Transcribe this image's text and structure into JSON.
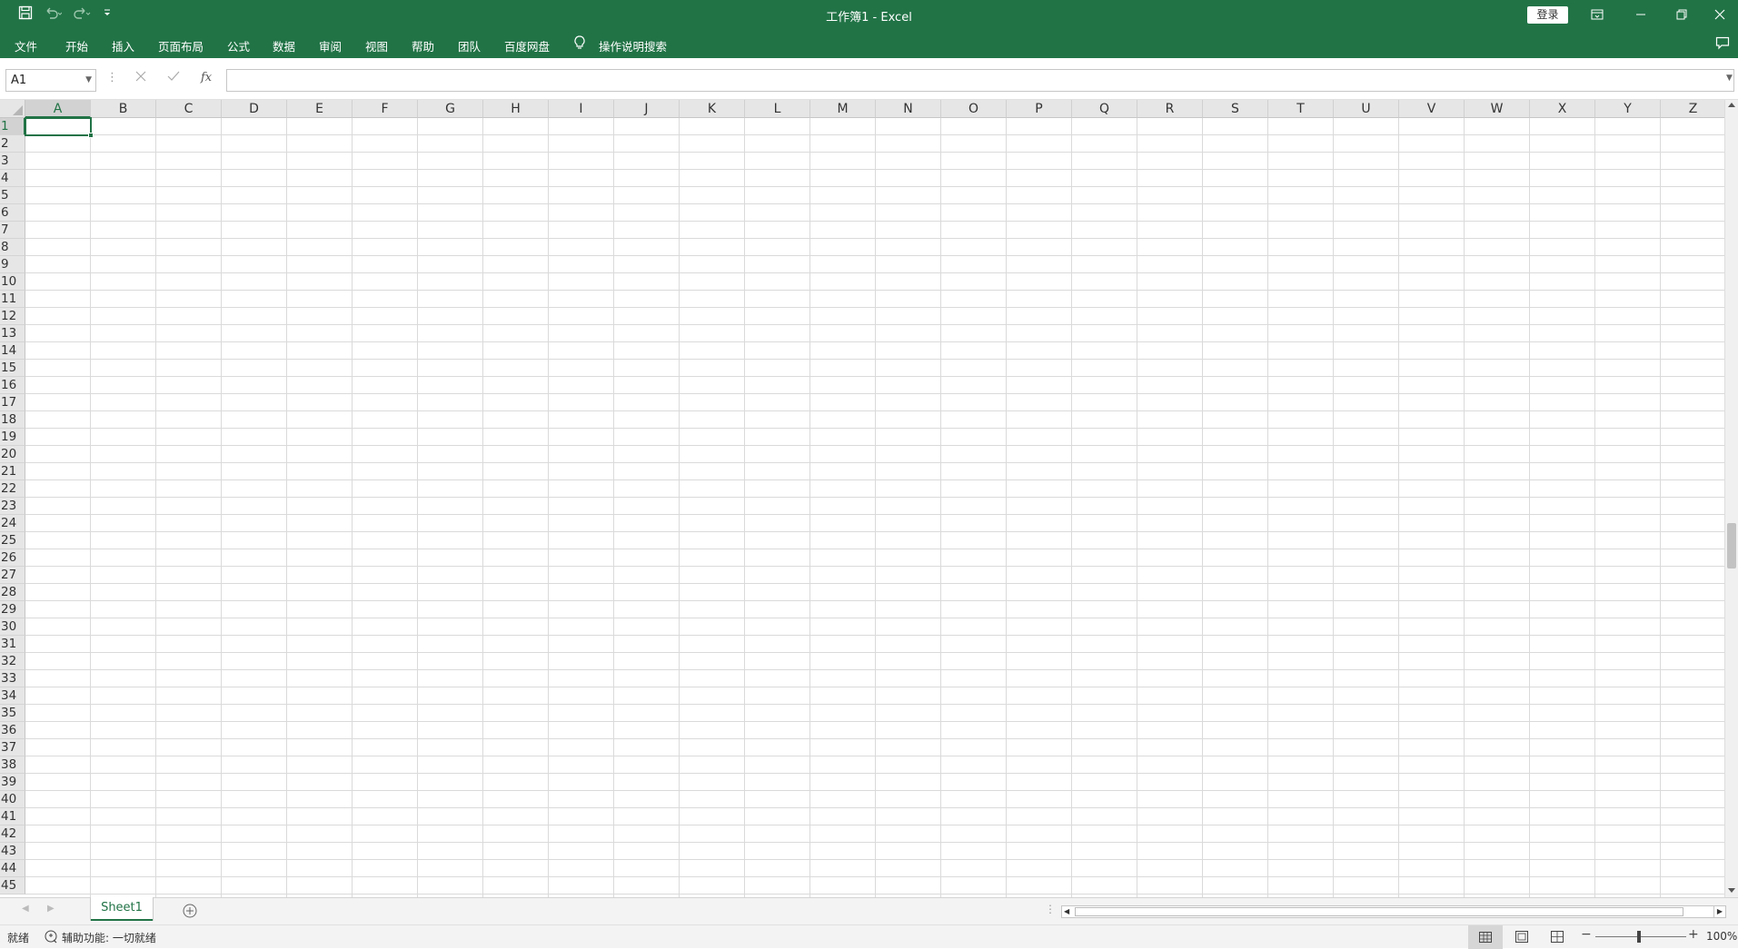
{
  "title_bar": {
    "title": "工作簿1  -  Excel",
    "login_label": "登录"
  },
  "menu": {
    "items": [
      "文件",
      "开始",
      "插入",
      "页面布局",
      "公式",
      "数据",
      "审阅",
      "视图",
      "帮助",
      "团队",
      "百度网盘"
    ],
    "tell_me": "操作说明搜索"
  },
  "formula_bar": {
    "name_box": "A1",
    "fx_label": "fx",
    "formula": ""
  },
  "grid": {
    "columns": [
      "A",
      "B",
      "C",
      "D",
      "E",
      "F",
      "G",
      "H",
      "I",
      "J",
      "K",
      "L",
      "M",
      "N",
      "O",
      "P",
      "Q",
      "R",
      "S",
      "T",
      "U",
      "V",
      "W",
      "X",
      "Y",
      "Z"
    ],
    "rows": [
      "1",
      "2",
      "3",
      "4",
      "5",
      "6",
      "7",
      "8",
      "9",
      "10",
      "11",
      "12",
      "13",
      "14",
      "15",
      "16",
      "17",
      "18",
      "19",
      "20",
      "21",
      "22",
      "23",
      "24",
      "25",
      "26",
      "27",
      "28",
      "29",
      "30",
      "31",
      "32",
      "33",
      "34",
      "35",
      "36",
      "37",
      "38",
      "39",
      "40",
      "41",
      "42",
      "43",
      "44",
      "45"
    ],
    "active_cell": "A1"
  },
  "sheets": {
    "tabs": [
      "Sheet1"
    ]
  },
  "status": {
    "ready": "就绪",
    "accessibility": "辅助功能: 一切就绪",
    "zoom": "100%"
  },
  "colors": {
    "accent": "#217346",
    "header_bg": "#e6e6e6",
    "gridline": "#dadada"
  }
}
